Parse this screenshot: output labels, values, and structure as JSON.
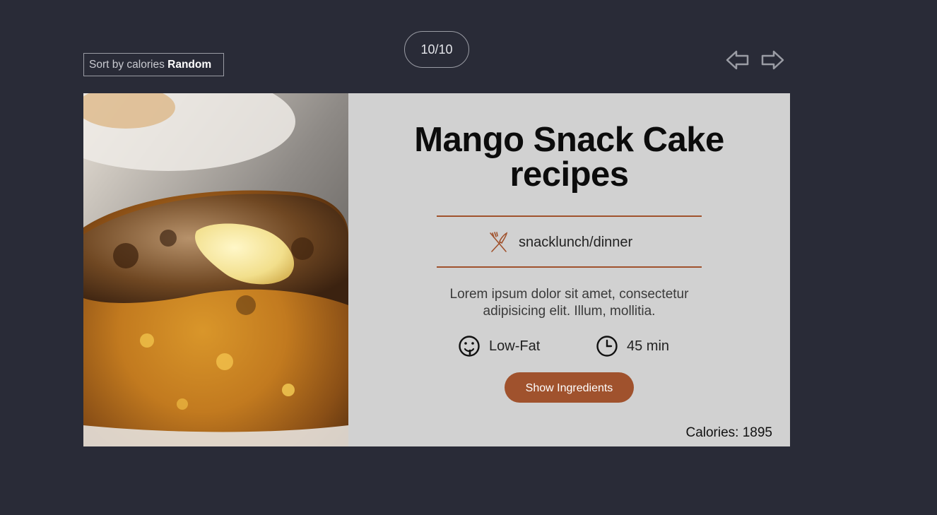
{
  "controls": {
    "sort_label": "Sort by calories",
    "sort_value": "Random",
    "counter": "10/10",
    "prev_icon": "arrow-left-outline-icon",
    "next_icon": "arrow-right-outline-icon"
  },
  "recipe": {
    "title_line1": "Mango Snack Cake",
    "title_line2": "recipes",
    "meal_type": "snacklunch/dinner",
    "meal_icon": "fork-knife-icon",
    "description_line1": "Lorem ipsum dolor sit amet, consectetur",
    "description_line2": "adipisicing elit. Illum, mollitia.",
    "diet": "Low-Fat",
    "diet_icon": "face-icon",
    "time": "45 min",
    "time_icon": "clock-icon",
    "button_label": "Show Ingredients",
    "calories": "Calories: 1895",
    "image_alt": "mango-snack-cake-photo"
  },
  "colors": {
    "background": "#292b37",
    "card": "#d1d1d1",
    "accent": "#a0522d"
  }
}
